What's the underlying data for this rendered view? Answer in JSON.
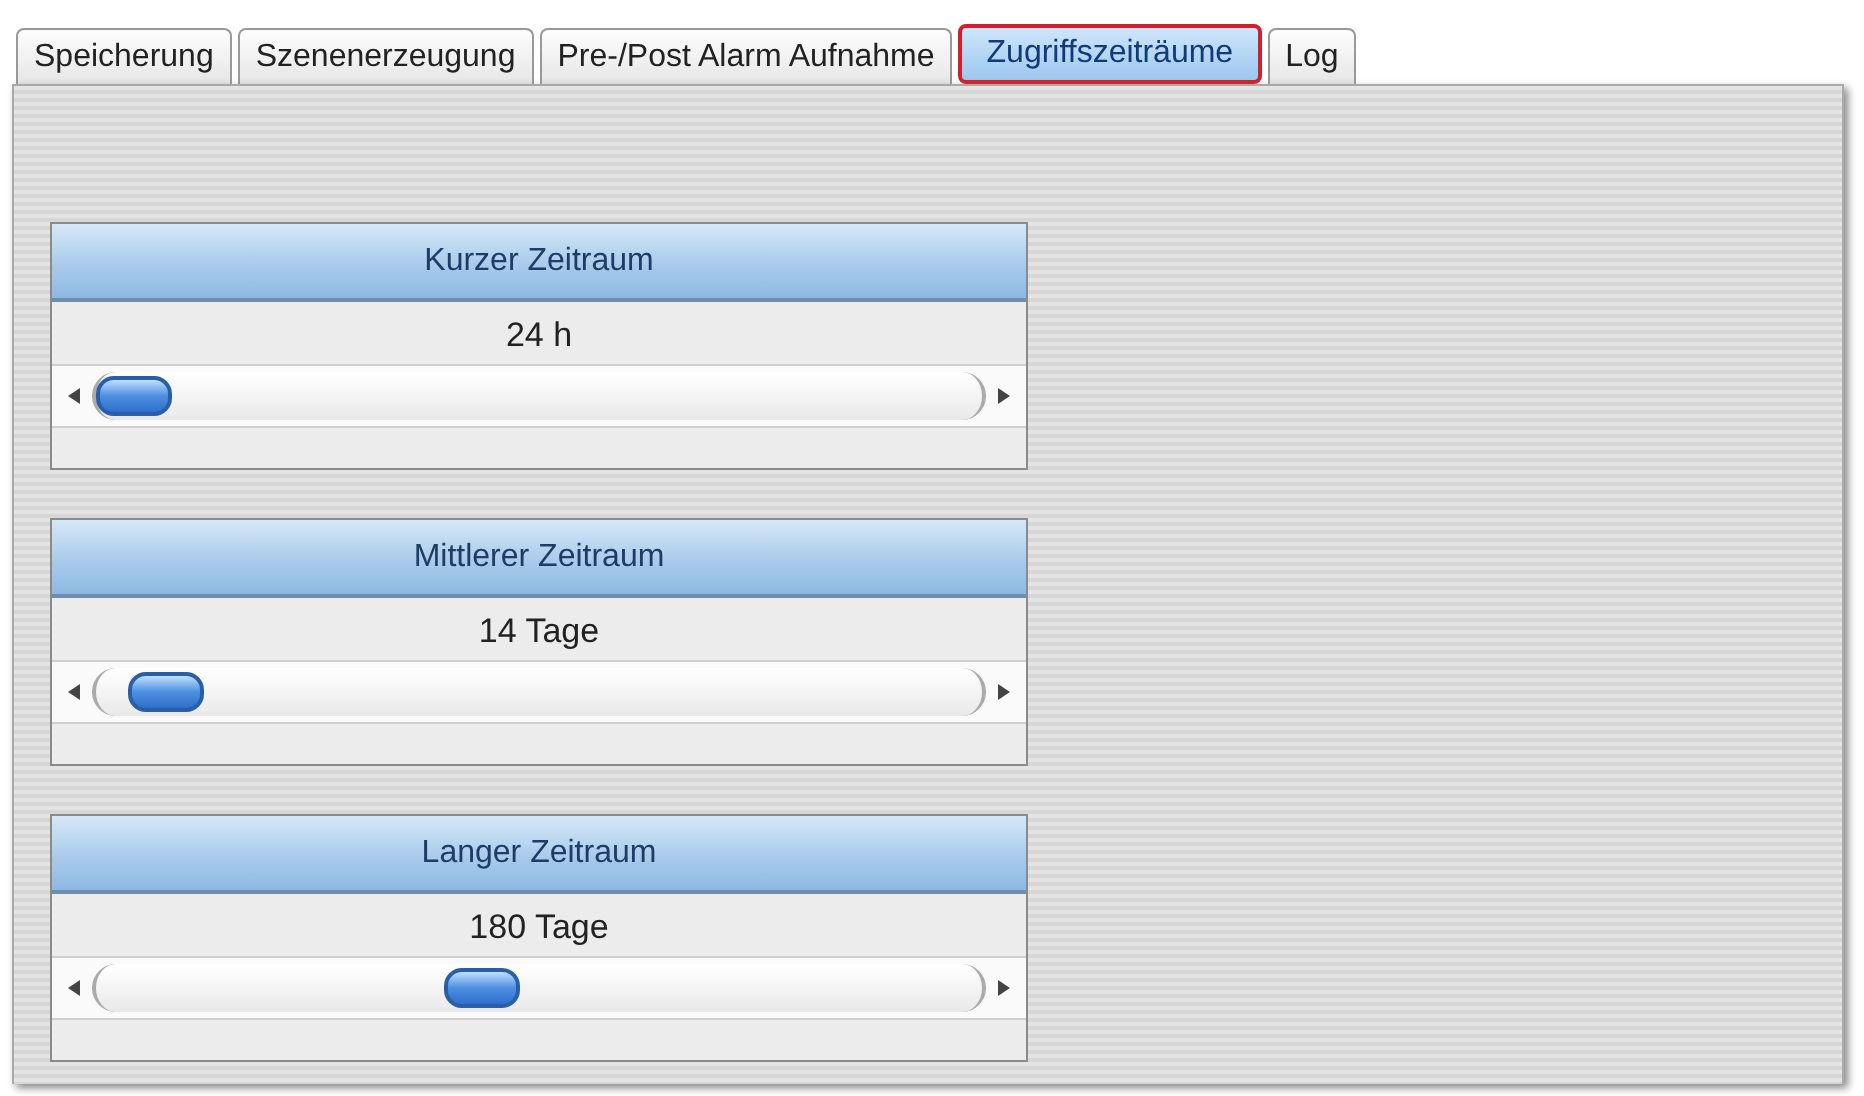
{
  "tabs": [
    {
      "label": "Speicherung",
      "selected": false
    },
    {
      "label": "Szenenerzeugung",
      "selected": false
    },
    {
      "label": "Pre-/Post Alarm Aufnahme",
      "selected": false
    },
    {
      "label": "Zugriffszeiträume",
      "selected": true
    },
    {
      "label": "Log",
      "selected": false
    }
  ],
  "groups": [
    {
      "title": "Kurzer Zeitraum",
      "reading": "24 h",
      "level": 0
    },
    {
      "title": "Mittlerer Zeitraum",
      "reading": "14 Tage",
      "level": 0.04
    },
    {
      "title": "Langer Zeitraum",
      "reading": "180 Tage",
      "level": 0.43
    }
  ]
}
